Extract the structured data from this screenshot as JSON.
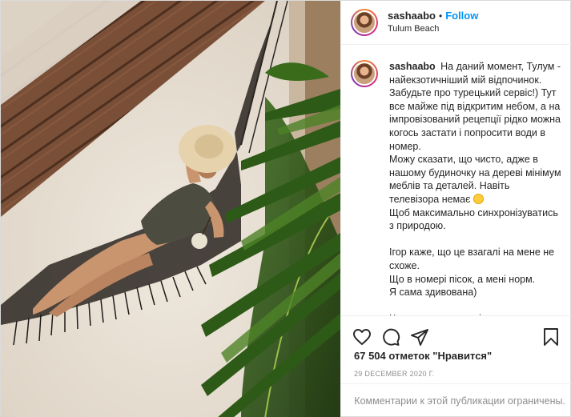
{
  "post": {
    "username": "sashaabo",
    "follow_label": "Follow",
    "location": "Tulum Beach",
    "dot": "•"
  },
  "caption": {
    "username": "sashaabo",
    "text": "На даний момент, Тулум - найекзотичніший мій відпочинок. Забудьте про турецький сервіс!) Тут все майже під відкритим небом, а на імпровізований рецепції рідко можна когось застати і попросити води в номер.\nМожу сказати, що чисто, адже в нашому будиночку на дереві мінімум меблів та деталей. Навіть телевізора немає",
    "text2": "\nЩоб максимально синхронізуватись з природою.\n\nІгор каже, що це взагалі на мене не схоже.\nЩо в номері пісок, а мені норм.\nЯ сама здивована)\n\nЧасто в мого чоловіка виникали"
  },
  "stats": {
    "likes": "67 504 отметок \"Нравится\"",
    "date": "29 DECEMBER 2020 Г."
  },
  "comments_notice": "Комментарии к этой публикации ограничены.",
  "icons": [
    "heart-icon",
    "comment-icon",
    "share-icon",
    "bookmark-icon",
    "smiling-face-emoji"
  ],
  "colors": {
    "accent": "#0095f6",
    "muted": "#8e8e8e",
    "text": "#262626"
  }
}
